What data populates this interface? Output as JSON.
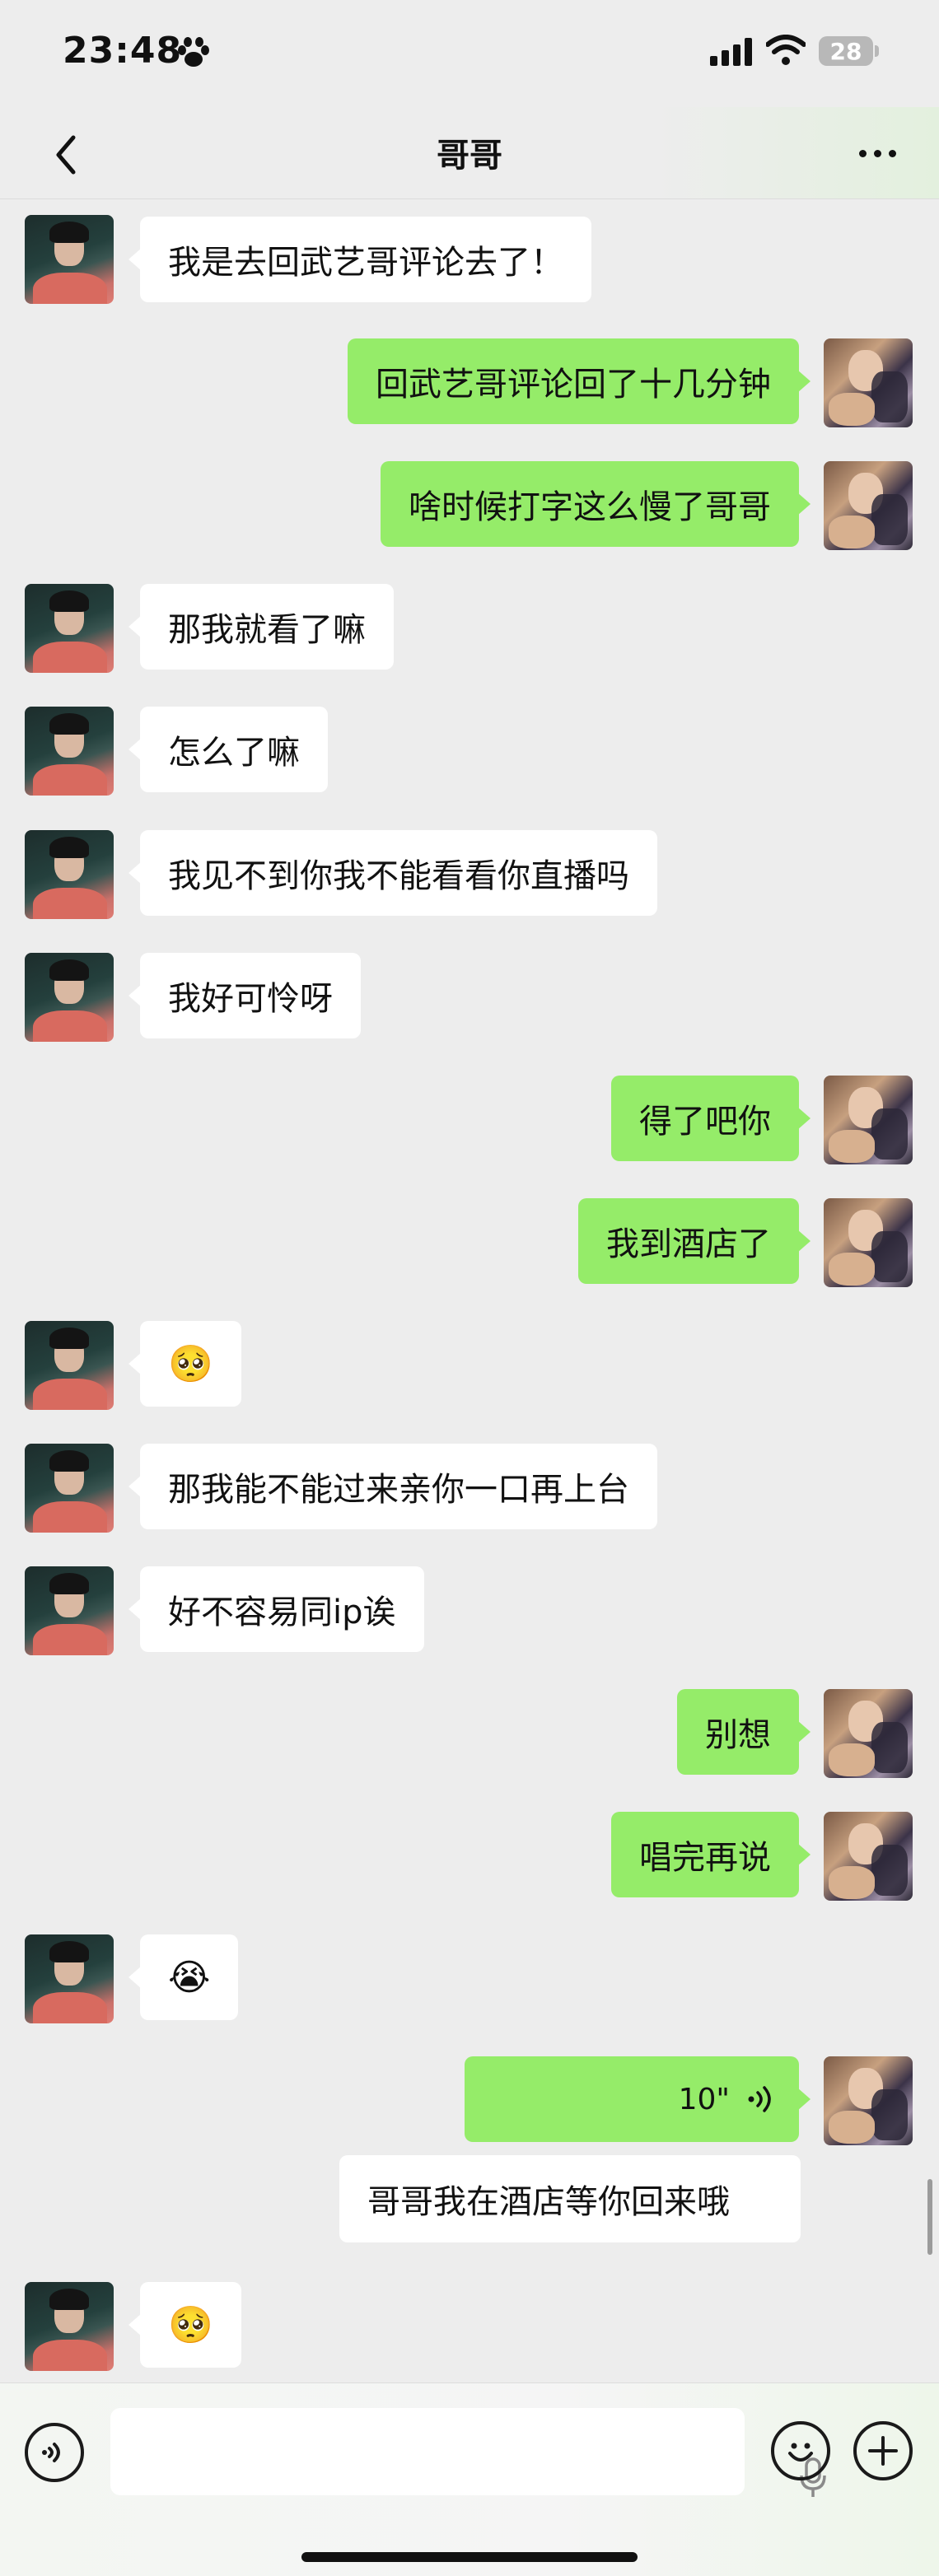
{
  "status": {
    "time": "23:48",
    "battery": "28"
  },
  "nav": {
    "title": "哥哥"
  },
  "messages": [
    {
      "side": "in",
      "text": "我是去回武艺哥评论去了！"
    },
    {
      "side": "out",
      "text": "回武艺哥评论回了十几分钟"
    },
    {
      "side": "out",
      "text": "啥时候打字这么慢了哥哥"
    },
    {
      "side": "in",
      "text": "那我就看了嘛"
    },
    {
      "side": "in",
      "text": "怎么了嘛"
    },
    {
      "side": "in",
      "text": "我见不到你我不能看看你直播吗"
    },
    {
      "side": "in",
      "text": "我好可怜呀"
    },
    {
      "side": "out",
      "text": "得了吧你"
    },
    {
      "side": "out",
      "text": "我到酒店了"
    },
    {
      "side": "in",
      "text": "🥺"
    },
    {
      "side": "in",
      "text": "那我能不能过来亲你一口再上台"
    },
    {
      "side": "in",
      "text": "好不容易同ip诶"
    },
    {
      "side": "out",
      "text": "别想"
    },
    {
      "side": "out",
      "text": "唱完再说"
    },
    {
      "side": "in",
      "text": "😭"
    },
    {
      "side": "out",
      "text": "10\"",
      "voice": true,
      "transcript": "哥哥我在酒店等你回来哦"
    },
    {
      "side": "in",
      "text": "🥺"
    }
  ],
  "input": {
    "placeholder": ""
  },
  "icons": [
    "back-arrow-icon",
    "more-icon",
    "voice-mode-icon",
    "mic-icon",
    "emoji-icon",
    "plus-icon",
    "paw-icon",
    "signal-icon",
    "wifi-icon",
    "battery-icon"
  ],
  "colors": {
    "outgoing_bubble": "#95ec69",
    "incoming_bubble": "#ffffff",
    "background": "#ededed"
  }
}
